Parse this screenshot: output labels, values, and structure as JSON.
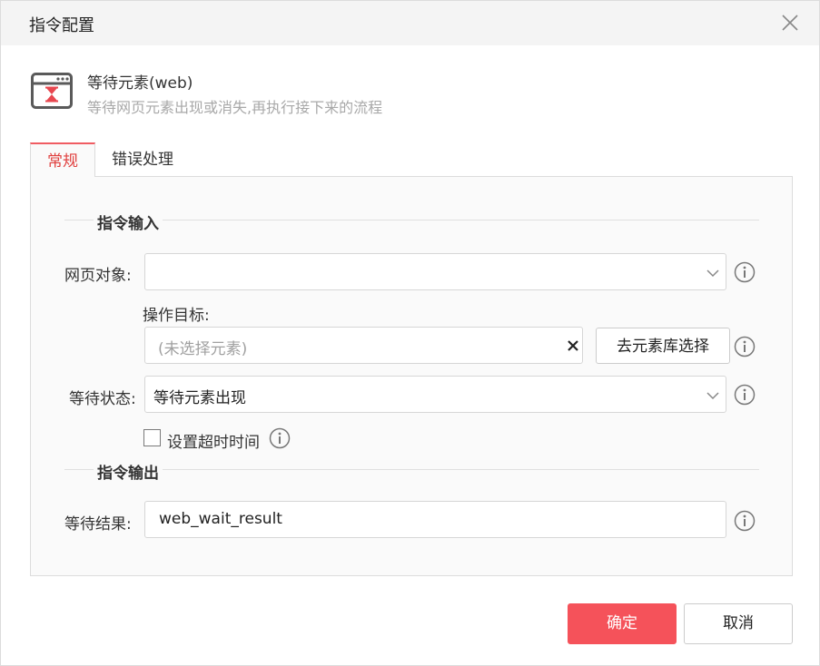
{
  "dialog": {
    "title": "指令配置",
    "close_icon": "close-icon"
  },
  "command": {
    "icon": "browser-hourglass-icon",
    "name": "等待元素(web)",
    "description": "等待网页元素出现或消失,再执行接下来的流程"
  },
  "tabs": [
    {
      "label": "常规",
      "active": true
    },
    {
      "label": "错误处理",
      "active": false
    }
  ],
  "input_section": {
    "title": "指令输入",
    "web_object": {
      "label": "网页对象:",
      "value": ""
    },
    "target": {
      "label": "操作目标:",
      "placeholder": "(未选择元素)",
      "pick_button": "去元素库选择"
    },
    "wait_state": {
      "label": "等待状态:",
      "value": "等待元素出现"
    },
    "timeout": {
      "label": "设置超时时间",
      "checked": false
    }
  },
  "output_section": {
    "title": "指令输出",
    "result": {
      "label": "等待结果:",
      "value": "web_wait_result"
    }
  },
  "footer": {
    "confirm": "确定",
    "cancel": "取消"
  },
  "colors": {
    "accent": "#f5525a",
    "tab_active_text": "#e0403f",
    "icon_red": "#e8474f",
    "icon_gray": "#5a5a5a"
  }
}
